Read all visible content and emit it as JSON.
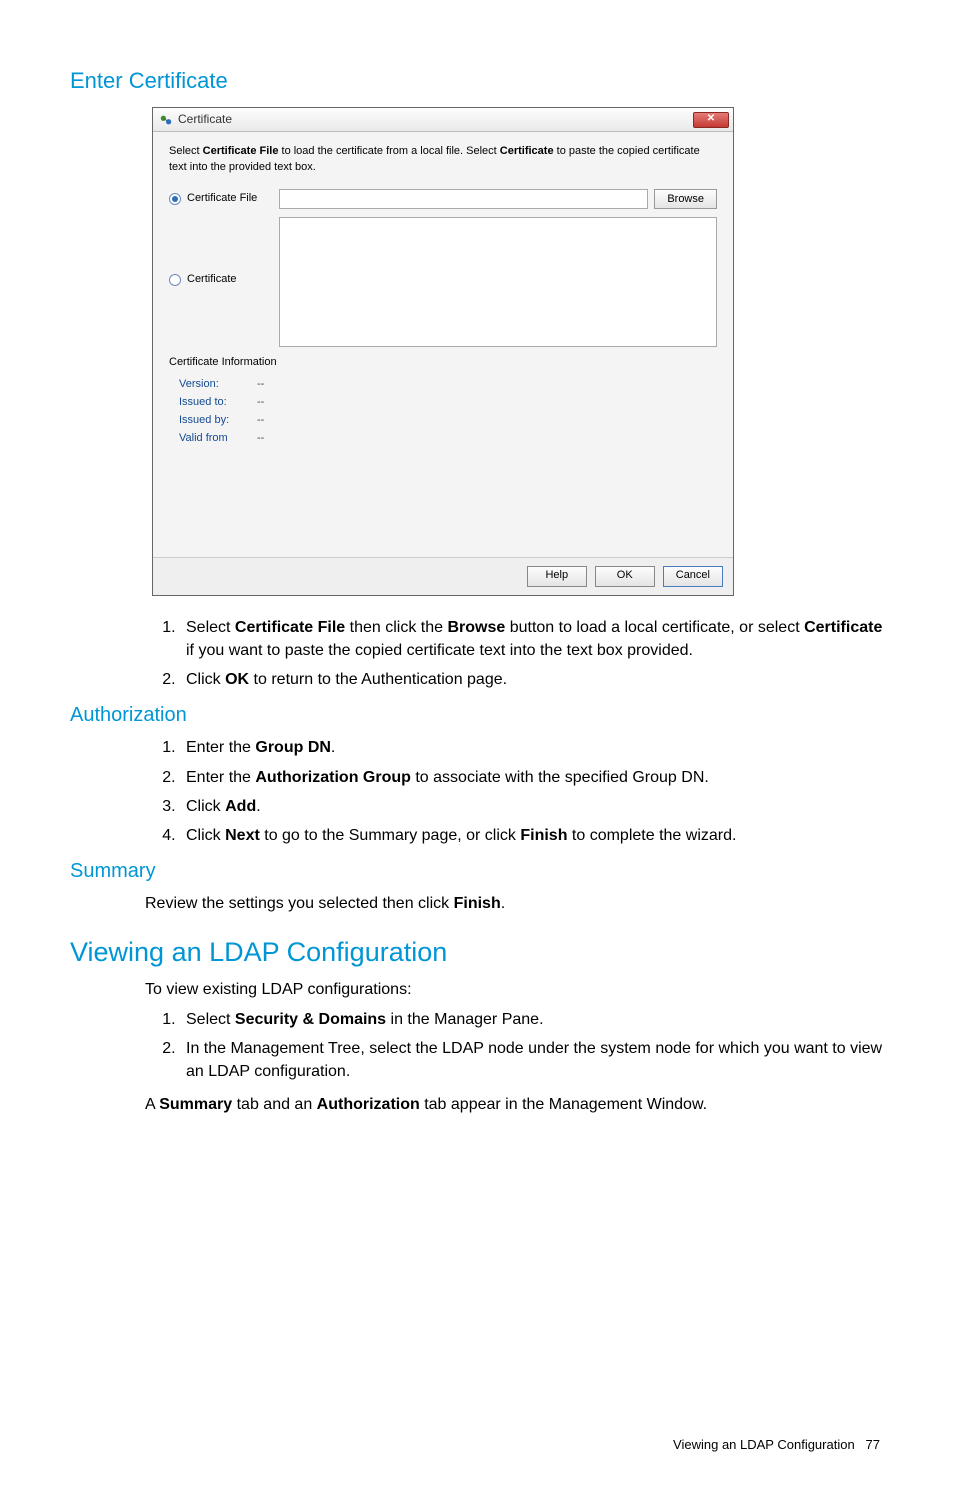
{
  "sections": {
    "enter_cert": "Enter Certificate",
    "authorization": "Authorization",
    "summary": "Summary",
    "viewing": "Viewing an LDAP Configuration"
  },
  "dialog": {
    "title": "Certificate",
    "instruction_pre": "Select ",
    "instruction_b1": "Certificate File",
    "instruction_mid": " to load the certificate from a local file. Select ",
    "instruction_b2": "Certificate",
    "instruction_post": " to paste the copied certificate text into the provided text box.",
    "radio_file": "Certificate File",
    "radio_cert": "Certificate",
    "browse": "Browse",
    "info_heading": "Certificate Information",
    "info": {
      "version_l": "Version:",
      "version_v": "--",
      "issued_to_l": "Issued to:",
      "issued_to_v": "--",
      "issued_by_l": "Issued by:",
      "issued_by_v": "--",
      "valid_from_l": "Valid from",
      "valid_from_v": "--"
    },
    "help": "Help",
    "ok": "OK",
    "cancel": "Cancel"
  },
  "enter_cert_steps": {
    "s1_pre": "Select ",
    "s1_b1": "Certificate File",
    "s1_mid": " then click the ",
    "s1_b2": "Browse",
    "s1_mid2": " button to load a local certificate, or select ",
    "s1_b3": "Certificate",
    "s1_post": " if you want to paste the copied certificate text into the text box provided.",
    "s2_pre": "Click ",
    "s2_b": "OK",
    "s2_post": " to return to the Authentication page."
  },
  "auth_steps": {
    "s1_pre": "Enter the ",
    "s1_b": "Group DN",
    "s1_post": ".",
    "s2_pre": "Enter the ",
    "s2_b": "Authorization Group",
    "s2_post": " to associate with the specified Group DN.",
    "s3_pre": "Click ",
    "s3_b": "Add",
    "s3_post": ".",
    "s4_pre": "Click ",
    "s4_b1": "Next",
    "s4_mid": " to go to the Summary page, or click ",
    "s4_b2": "Finish",
    "s4_post": " to complete the wizard."
  },
  "summary_body_pre": "Review the settings you selected then click ",
  "summary_body_b": "Finish",
  "summary_body_post": ".",
  "viewing_intro": "To view existing LDAP configurations:",
  "viewing_steps": {
    "s1_pre": "Select ",
    "s1_b": "Security & Domains",
    "s1_post": " in the Manager Pane.",
    "s2": "In the Management Tree, select the LDAP node under the system node for which you want to view an LDAP configuration."
  },
  "viewing_tail_pre": "A ",
  "viewing_tail_b1": "Summary",
  "viewing_tail_mid": " tab and an ",
  "viewing_tail_b2": "Authorization",
  "viewing_tail_post": " tab appear in the Management Window.",
  "footer_label": "Viewing an LDAP Configuration",
  "footer_page": "77"
}
